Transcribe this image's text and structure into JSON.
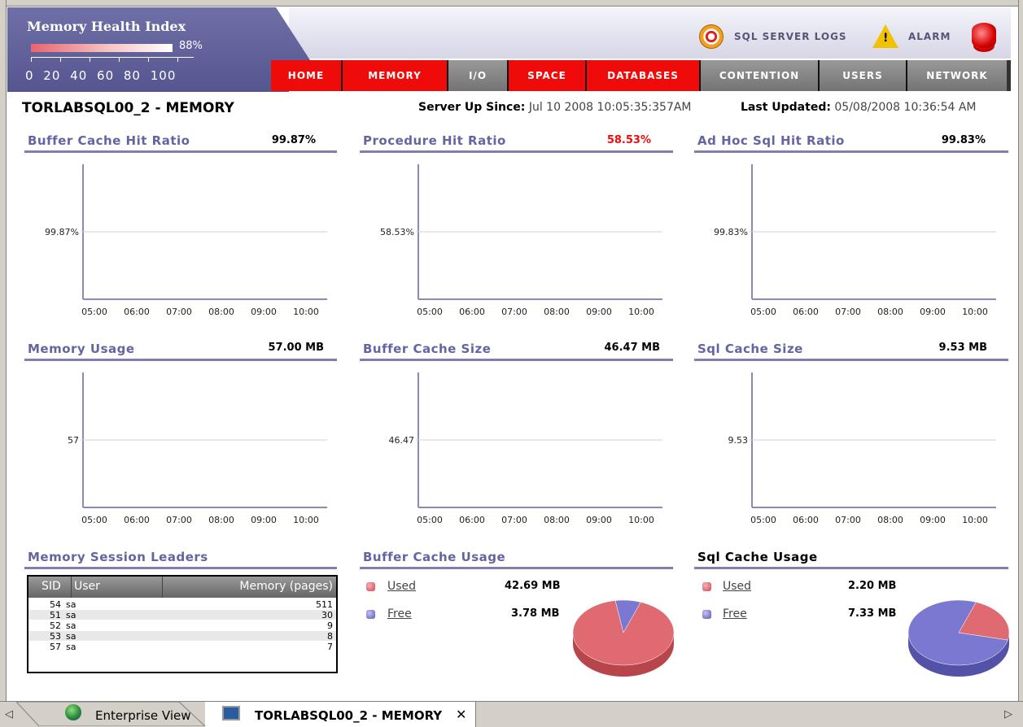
{
  "health": {
    "title": "Memory Health Index",
    "percent": "88%",
    "value": 0.88,
    "scale": "0 20 40 60 80 100"
  },
  "toplinks": {
    "sql_logs": "SQL SERVER LOGS",
    "alarm": "ALARM"
  },
  "nav": [
    {
      "label": "HOME",
      "style": "red"
    },
    {
      "label": "MEMORY",
      "style": "red"
    },
    {
      "label": "I/O",
      "style": "gray"
    },
    {
      "label": "SPACE",
      "style": "red"
    },
    {
      "label": "DATABASES",
      "style": "red"
    },
    {
      "label": "CONTENTION",
      "style": "gray"
    },
    {
      "label": "USERS",
      "style": "gray"
    },
    {
      "label": "NETWORK",
      "style": "gray"
    }
  ],
  "page": {
    "title": "TORLABSQL00_2 - MEMORY",
    "uptime_key": "Server Up Since:",
    "uptime_value": "Jul 10 2008 10:05:35:357AM",
    "updated_key": "Last Updated:",
    "updated_value": "05/08/2008 10:36:54 AM"
  },
  "panels": {
    "p1": {
      "title": "Buffer Cache Hit Ratio",
      "value": "99.87%"
    },
    "p2": {
      "title": "Procedure Hit Ratio",
      "value": "58.53%"
    },
    "p3": {
      "title": "Ad Hoc Sql Hit Ratio",
      "value": "99.83%"
    },
    "p4": {
      "title": "Memory Usage",
      "value": "57.00 MB"
    },
    "p5": {
      "title": "Buffer Cache Size",
      "value": "46.47 MB"
    },
    "p6": {
      "title": "Sql Cache Size",
      "value": "9.53 MB"
    },
    "p7": {
      "title": "Memory Session Leaders"
    },
    "p8": {
      "title": "Buffer Cache Usage"
    },
    "p9": {
      "title": "Sql Cache Usage"
    }
  },
  "colors": {
    "accent": "#6464a0",
    "nav_red": "#f00b0b",
    "alert_red": "#f00b0b",
    "used": "#e06a72",
    "free": "#7a78d0"
  },
  "chart_data": [
    {
      "type": "line",
      "title": "Buffer Cache Hit Ratio",
      "x": [
        "05:00",
        "06:00",
        "07:00",
        "08:00",
        "09:00",
        "10:00"
      ],
      "y_tick": "99.87%",
      "series": []
    },
    {
      "type": "line",
      "title": "Procedure Hit Ratio",
      "x": [
        "05:00",
        "06:00",
        "07:00",
        "08:00",
        "09:00",
        "10:00"
      ],
      "y_tick": "58.53%",
      "series": []
    },
    {
      "type": "line",
      "title": "Ad Hoc Sql Hit Ratio",
      "x": [
        "05:00",
        "06:00",
        "07:00",
        "08:00",
        "09:00",
        "10:00"
      ],
      "y_tick": "99.83%",
      "series": []
    },
    {
      "type": "line",
      "title": "Memory Usage",
      "x": [
        "05:00",
        "06:00",
        "07:00",
        "08:00",
        "09:00",
        "10:00"
      ],
      "y_tick": "57",
      "series": []
    },
    {
      "type": "line",
      "title": "Buffer Cache Size",
      "x": [
        "05:00",
        "06:00",
        "07:00",
        "08:00",
        "09:00",
        "10:00"
      ],
      "y_tick": "46.47",
      "series": []
    },
    {
      "type": "line",
      "title": "Sql Cache Size",
      "x": [
        "05:00",
        "06:00",
        "07:00",
        "08:00",
        "09:00",
        "10:00"
      ],
      "y_tick": "9.53",
      "series": []
    },
    {
      "type": "pie",
      "title": "Buffer Cache Usage",
      "categories": [
        "Used",
        "Free"
      ],
      "values": [
        42.69,
        3.78
      ],
      "labels": [
        "42.69 MB",
        "3.78 MB"
      ]
    },
    {
      "type": "pie",
      "title": "Sql Cache Usage",
      "categories": [
        "Used",
        "Free"
      ],
      "values": [
        2.2,
        7.33
      ],
      "labels": [
        "2.20 MB",
        "7.33 MB"
      ]
    }
  ],
  "sessions": {
    "headers": [
      "SID",
      "User",
      "Memory (pages)"
    ],
    "rows": [
      {
        "sid": "54",
        "user": "sa",
        "mem": "511"
      },
      {
        "sid": "51",
        "user": "sa",
        "mem": "30"
      },
      {
        "sid": "52",
        "user": "sa",
        "mem": "9"
      },
      {
        "sid": "53",
        "user": "sa",
        "mem": "8"
      },
      {
        "sid": "57",
        "user": "sa",
        "mem": "7"
      }
    ]
  },
  "tabs": {
    "enterprise": "Enterprise View",
    "current": "TORLABSQL00_2 - MEMORY",
    "close": "✕",
    "scroll_left": "◁",
    "scroll_right": "▷"
  }
}
